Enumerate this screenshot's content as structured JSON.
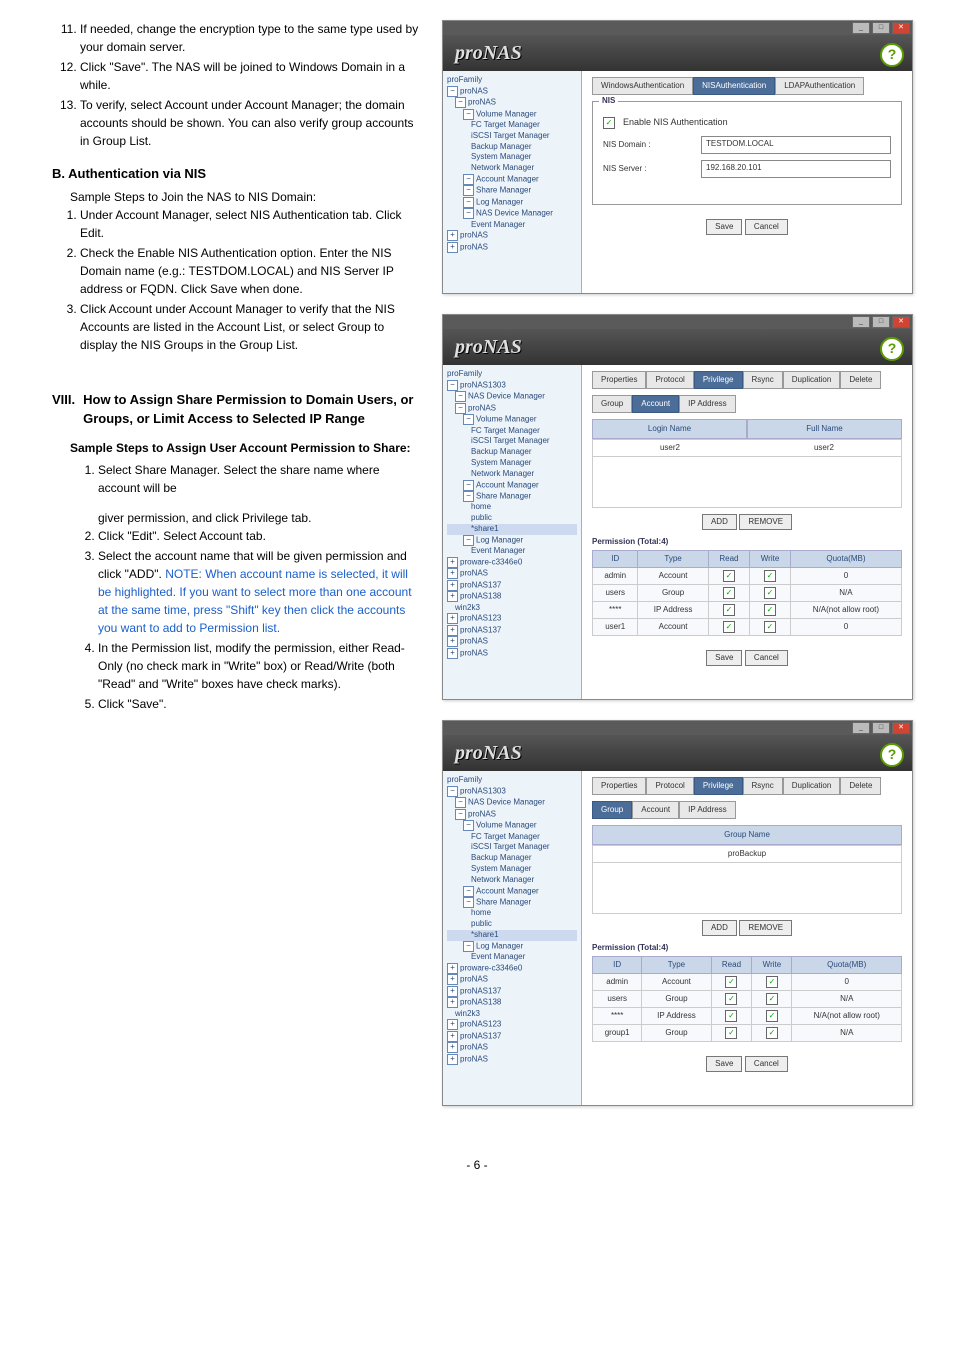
{
  "left_col": {
    "ol_top": [
      "If needed, change the encryption type to the same type used by your domain server.",
      "Click \"Save\".  The NAS will be joined to Windows Domain in a while.",
      "To verify, select Account under Account Manager; the domain accounts should be shown. You can also verify group accounts in Group List."
    ],
    "B_head": "B.  Authentication via NIS",
    "B_intro": "Sample Steps to Join the NAS to NIS Domain:",
    "B_list": [
      "Under Account Manager, select NIS Authentication tab. Click Edit.",
      "Check the Enable NIS Authentication option.  Enter the NIS Domain name (e.g.: TESTDOM.LOCAL) and NIS Server IP address or FQDN.  Click Save when done.",
      "Click Account under Account Manager to verify that the NIS Accounts are listed in the Account List, or select Group to display the NIS Groups in the Group List."
    ],
    "VIII_head": "VIII.",
    "VIII_body": "How to Assign Share Permission to Domain Users, or Groups, or Limit Access to Selected IP Range",
    "sample_head": "Sample Steps to Assign User Account Permission to Share:",
    "sample_list_1": "Select Share Manager. Select the share name where account will be",
    "sample_list_1b": "giver permission, and click Privilege tab.",
    "sample_list": [
      "Click \"Edit\". Select Account tab.",
      "Select the account name that will be given permission and click \"ADD\". ",
      "In the Permission list, modify the permission, either Read-Only (no check mark in \"Write\" box) or Read/Write (both \"Read\" and \"Write\" boxes have check marks).",
      "Click \"Save\"."
    ],
    "note_text": "NOTE: When account name is selected, it will be highlighted. If you want to select more than one account at the same time, press \"Shift\" key then click the accounts you want to add to Permission list."
  },
  "shot1": {
    "logo": "proNAS",
    "tabs": [
      "WindowsAuthentication",
      "NISAuthentication",
      "LDAPAuthentication"
    ],
    "legend": "NIS",
    "chk_label": "Enable NIS Authentication",
    "f1_label": "NIS Domain :",
    "f1_val": "TESTDOM.LOCAL",
    "f2_label": "NIS Server :",
    "f2_val": "192.168.20.101",
    "save": "Save",
    "cancel": "Cancel",
    "tree": [
      [
        "l1",
        "proFamily",
        ""
      ],
      [
        "l1",
        "proNAS",
        "mi"
      ],
      [
        "l2",
        "proNAS",
        "mi"
      ],
      [
        "l3",
        "Volume Manager",
        "mi"
      ],
      [
        "l4",
        "FC Target Manager",
        ""
      ],
      [
        "l4",
        "iSCSI Target Manager",
        ""
      ],
      [
        "l4",
        "Backup Manager",
        ""
      ],
      [
        "l4",
        "System Manager",
        ""
      ],
      [
        "l4",
        "Network Manager",
        ""
      ],
      [
        "l3",
        "Account Manager",
        "mi"
      ],
      [
        "l3",
        "Share Manager",
        "mi"
      ],
      [
        "l3",
        "Log Manager",
        "mi"
      ],
      [
        "l3",
        "NAS Device Manager",
        "mi"
      ],
      [
        "l4",
        "Event Manager",
        ""
      ],
      [
        "l1",
        "proNAS",
        "pl"
      ],
      [
        "l1",
        "proNAS",
        "pl"
      ]
    ]
  },
  "shot2": {
    "logo": "proNAS",
    "tabs1": [
      "Properties",
      "Protocol",
      "Privilege",
      "Rsync",
      "Duplication",
      "Delete"
    ],
    "tabs2": [
      "Group",
      "Account",
      "IP Address"
    ],
    "hd_login": "Login Name",
    "hd_full": "Full Name",
    "acct_login": "user2",
    "acct_full": "user2",
    "add": "ADD",
    "remove": "REMOVE",
    "perm_legend": "Permission (Total:4)",
    "cols": [
      "ID",
      "Type",
      "Read",
      "Write",
      "Quota(MB)"
    ],
    "rows": [
      [
        "admin",
        "Account",
        "✓",
        "✓",
        "0"
      ],
      [
        "users",
        "Group",
        "✓",
        "✓",
        "N/A"
      ],
      [
        "****",
        "IP Address",
        "✓",
        "✓",
        "N/A(not allow root)"
      ],
      [
        "user1",
        "Account",
        "✓",
        "✓",
        "0"
      ]
    ],
    "save": "Save",
    "cancel": "Cancel",
    "tree": [
      [
        "l1",
        "proFamily",
        ""
      ],
      [
        "l1",
        "proNAS1303",
        "mi"
      ],
      [
        "l2",
        "NAS Device Manager",
        "mi"
      ],
      [
        "l2",
        "proNAS",
        "mi"
      ],
      [
        "l3",
        "Volume Manager",
        "mi"
      ],
      [
        "l4",
        "FC Target Manager",
        ""
      ],
      [
        "l4",
        "iSCSI Target Manager",
        ""
      ],
      [
        "l4",
        "Backup Manager",
        ""
      ],
      [
        "l4",
        "System Manager",
        ""
      ],
      [
        "l4",
        "Network Manager",
        ""
      ],
      [
        "l3",
        "Account Manager",
        "mi"
      ],
      [
        "l3",
        "Share Manager",
        "mi"
      ],
      [
        "l4",
        "home",
        ""
      ],
      [
        "l4",
        "public",
        ""
      ],
      [
        "l4",
        "*share1",
        "sel"
      ],
      [
        "l3",
        "Log Manager",
        "mi"
      ],
      [
        "l4",
        "Event Manager",
        ""
      ],
      [
        "l1",
        "proware-c3346e0",
        "pl"
      ],
      [
        "l1",
        "proNAS",
        "pl"
      ],
      [
        "l1",
        "proNAS137",
        "pl"
      ],
      [
        "l1",
        "proNAS138",
        "pl"
      ],
      [
        "l2",
        "win2k3",
        ""
      ],
      [
        "l1",
        "proNAS123",
        "pl"
      ],
      [
        "l1",
        "proNAS137",
        "pl"
      ],
      [
        "l1",
        "proNAS",
        "pl"
      ],
      [
        "l1",
        "proNAS",
        "pl"
      ]
    ]
  },
  "shot3": {
    "logo": "proNAS",
    "tabs1": [
      "Properties",
      "Protocol",
      "Privilege",
      "Rsync",
      "Duplication",
      "Delete"
    ],
    "tabs2": [
      "Group",
      "Account",
      "IP Address"
    ],
    "hd_group": "Group Name",
    "grp_val": "proBackup",
    "add": "ADD",
    "remove": "REMOVE",
    "perm_legend": "Permission (Total:4)",
    "cols": [
      "ID",
      "Type",
      "Read",
      "Write",
      "Quota(MB)"
    ],
    "rows": [
      [
        "admin",
        "Account",
        "✓",
        "✓",
        "0"
      ],
      [
        "users",
        "Group",
        "✓",
        "✓",
        "N/A"
      ],
      [
        "****",
        "IP Address",
        "✓",
        "✓",
        "N/A(not allow root)"
      ],
      [
        "group1",
        "Group",
        "✓",
        "✓",
        "N/A"
      ]
    ],
    "save": "Save",
    "cancel": "Cancel",
    "tree": [
      [
        "l1",
        "proFamily",
        ""
      ],
      [
        "l1",
        "proNAS1303",
        "mi"
      ],
      [
        "l2",
        "NAS Device Manager",
        "mi"
      ],
      [
        "l2",
        "proNAS",
        "mi"
      ],
      [
        "l3",
        "Volume Manager",
        "mi"
      ],
      [
        "l4",
        "FC Target Manager",
        ""
      ],
      [
        "l4",
        "iSCSI Target Manager",
        ""
      ],
      [
        "l4",
        "Backup Manager",
        ""
      ],
      [
        "l4",
        "System Manager",
        ""
      ],
      [
        "l4",
        "Network Manager",
        ""
      ],
      [
        "l3",
        "Account Manager",
        "mi"
      ],
      [
        "l3",
        "Share Manager",
        "mi"
      ],
      [
        "l4",
        "home",
        ""
      ],
      [
        "l4",
        "public",
        ""
      ],
      [
        "l4",
        "*share1",
        "sel"
      ],
      [
        "l3",
        "Log Manager",
        "mi"
      ],
      [
        "l4",
        "Event Manager",
        ""
      ],
      [
        "l1",
        "proware-c3346e0",
        "pl"
      ],
      [
        "l1",
        "proNAS",
        "pl"
      ],
      [
        "l1",
        "proNAS137",
        "pl"
      ],
      [
        "l1",
        "proNAS138",
        "pl"
      ],
      [
        "l2",
        "win2k3",
        ""
      ],
      [
        "l1",
        "proNAS123",
        "pl"
      ],
      [
        "l1",
        "proNAS137",
        "pl"
      ],
      [
        "l1",
        "proNAS",
        "pl"
      ],
      [
        "l1",
        "proNAS",
        "pl"
      ]
    ]
  },
  "footer": "- 6 -"
}
